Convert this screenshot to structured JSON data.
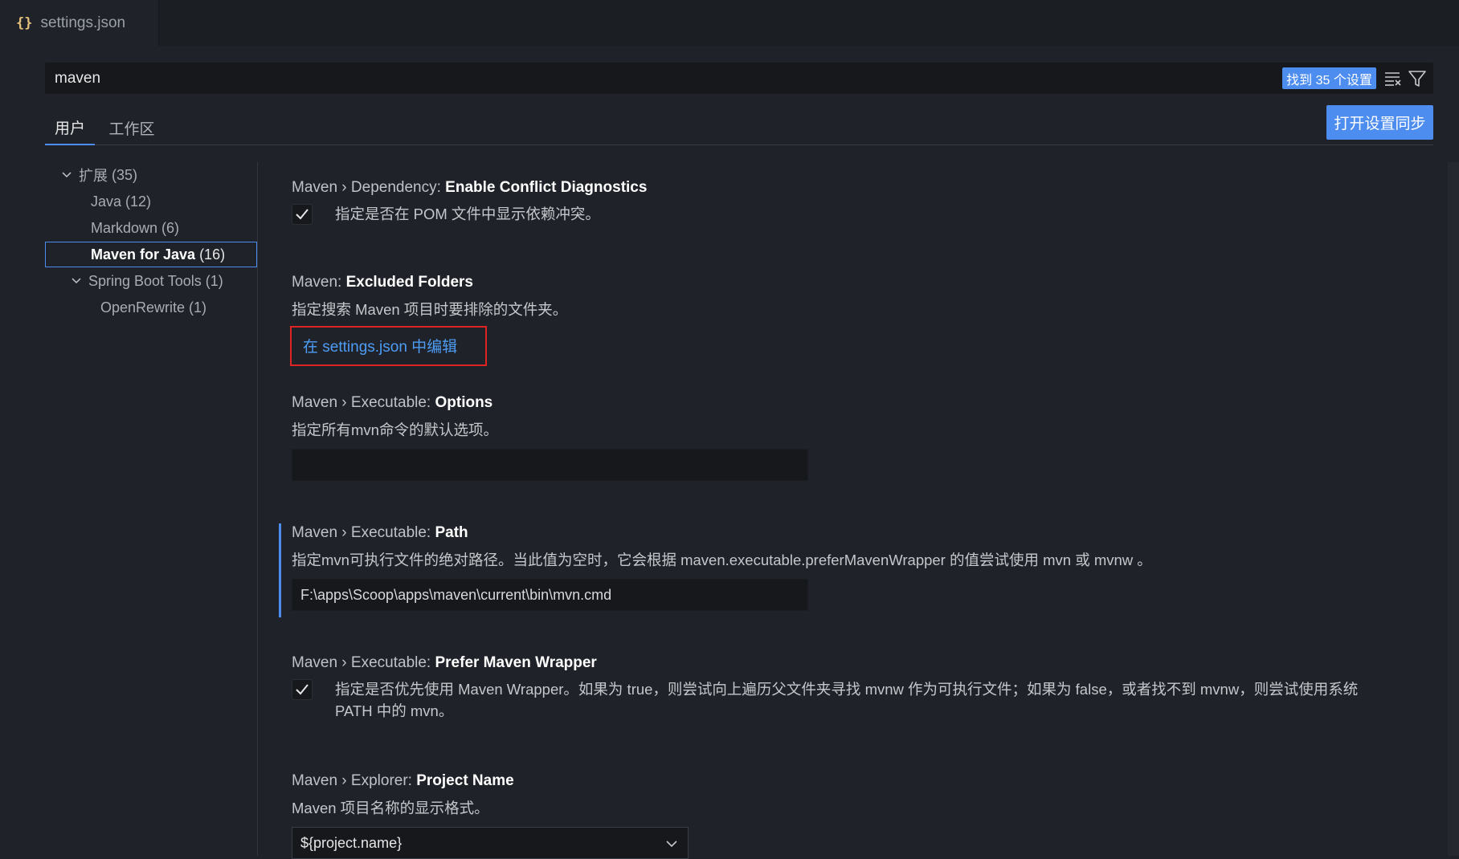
{
  "tab": {
    "icon": "json-braces-icon",
    "title": "settings.json"
  },
  "search": {
    "value": "maven",
    "result_badge": "找到 35 个设置"
  },
  "scopes": {
    "user": "用户",
    "workspace": "工作区"
  },
  "sync_button": "打开设置同步",
  "toc": [
    {
      "label": "扩展",
      "count": "(35)",
      "expanded": true,
      "level": 0
    },
    {
      "label": "Java",
      "count": "(12)",
      "level": 1
    },
    {
      "label": "Markdown",
      "count": "(6)",
      "level": 1
    },
    {
      "label": "Maven for Java",
      "count": "(16)",
      "level": 1,
      "selected": true
    },
    {
      "label": "Spring Boot Tools",
      "count": "(1)",
      "level": 1,
      "expanded": true
    },
    {
      "label": "OpenRewrite",
      "count": "(1)",
      "level": 2
    }
  ],
  "settings": {
    "conflict": {
      "prefix": "Maven › Dependency: ",
      "name": "Enable Conflict Diagnostics",
      "desc": "指定是否在 POM 文件中显示依赖冲突。",
      "checked": true
    },
    "excluded": {
      "prefix": "Maven: ",
      "name": "Excluded Folders",
      "desc": "指定搜索 Maven 项目时要排除的文件夹。",
      "link": "在 settings.json 中编辑"
    },
    "options": {
      "prefix": "Maven › Executable: ",
      "name": "Options",
      "desc": "指定所有mvn命令的默认选项。",
      "value": ""
    },
    "path": {
      "prefix": "Maven › Executable: ",
      "name": "Path",
      "desc": "指定mvn可执行文件的绝对路径。当此值为空时，它会根据 maven.executable.preferMavenWrapper 的值尝试使用 mvn 或 mvnw 。",
      "value": "F:\\apps\\Scoop\\apps\\maven\\current\\bin\\mvn.cmd"
    },
    "wrapper": {
      "prefix": "Maven › Executable: ",
      "name": "Prefer Maven Wrapper",
      "desc_line1": "指定是否优先使用 Maven Wrapper。如果为 true，则尝试向上遍历父文件夹寻找 mvnw 作为可执行文件；如果为 false，或者找不到 mvnw，则尝试使用系统",
      "desc_line2": "PATH 中的 mvn。",
      "checked": true
    },
    "project_name": {
      "prefix": "Maven › Explorer: ",
      "name": "Project Name",
      "desc": "Maven 项目名称的显示格式。",
      "value": "${project.name}"
    }
  },
  "colors": {
    "accent": "#4d8df0",
    "link": "#4d9cf5",
    "highlight": "#e02424"
  }
}
